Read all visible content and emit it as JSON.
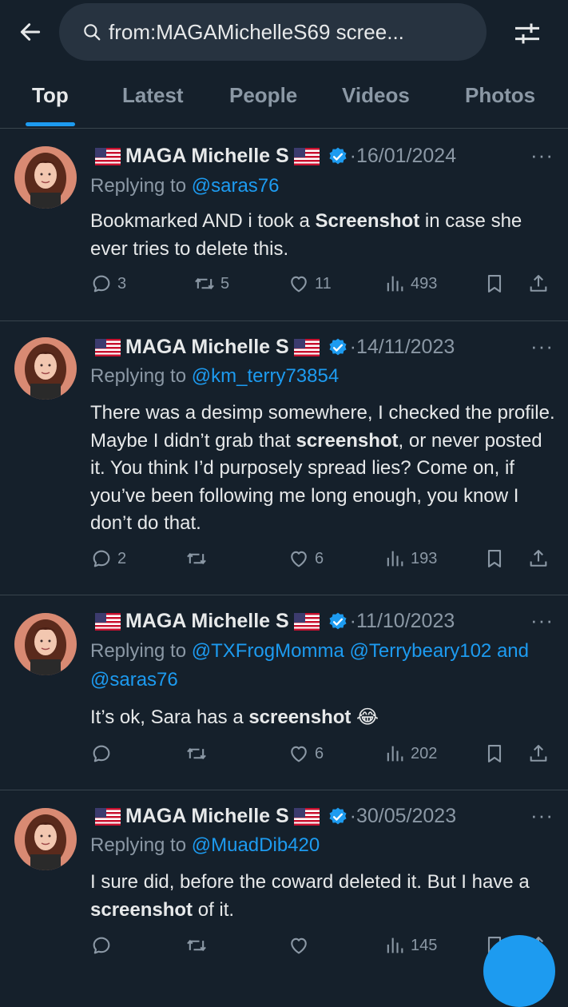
{
  "search": {
    "query": "from:MAGAMichelleS69 scree..."
  },
  "tabs": [
    {
      "label": "Top"
    },
    {
      "label": "Latest"
    },
    {
      "label": "People"
    },
    {
      "label": "Videos"
    },
    {
      "label": "Photos"
    }
  ],
  "colors": {
    "background": "#15202b",
    "accent": "#1d9bf0",
    "muted": "#8b98a5",
    "text": "#e7e9ea"
  },
  "tweets": [
    {
      "name": "MAGA Michelle S",
      "date": "·16/01/2024",
      "replying_prefix": "Replying to ",
      "mentions": [
        "@saras76"
      ],
      "text_parts": [
        "Bookmarked AND i took a ",
        "Screenshot",
        " in case she ever tries to delete this."
      ],
      "stats": {
        "replies": "3",
        "retweets": "5",
        "likes": "11",
        "views": "493"
      }
    },
    {
      "name": "MAGA Michelle S",
      "date": "·14/11/2023",
      "replying_prefix": "Replying to ",
      "mentions": [
        "@km_terry73854"
      ],
      "text_parts": [
        "There was a desimp somewhere, I checked the profile.  Maybe I didn’t grab that ",
        "screenshot",
        ", or never posted it.  You think I’d purposely spread lies?  Come on, if you’ve been following me long enough, you know I don’t do that."
      ],
      "stats": {
        "replies": "2",
        "retweets": "",
        "likes": "6",
        "views": "193"
      }
    },
    {
      "name": "MAGA Michelle S",
      "date": "·11/10/2023",
      "replying_prefix": "Replying to ",
      "mentions": [
        "@TXFrogMomma",
        "@Terrybeary102",
        "and",
        "@saras76"
      ],
      "text_parts": [
        "It’s ok, Sara has a ",
        "screenshot",
        " 😂"
      ],
      "stats": {
        "replies": "",
        "retweets": "",
        "likes": "6",
        "views": "202"
      }
    },
    {
      "name": "MAGA Michelle S",
      "date": "·30/05/2023",
      "replying_prefix": "Replying to ",
      "mentions": [
        "@MuadDib420"
      ],
      "text_parts": [
        "I sure did, before the coward deleted it. But I have a ",
        "screenshot",
        " of it."
      ],
      "stats": {
        "replies": "",
        "retweets": "",
        "likes": "",
        "views": "145"
      }
    }
  ],
  "icons": {
    "back": "back-arrow-icon",
    "search": "search-icon",
    "filter": "filter-sliders-icon",
    "more": "more-dots-icon",
    "reply": "reply-icon",
    "retweet": "retweet-icon",
    "like": "heart-icon",
    "views": "views-bar-icon",
    "bookmark": "bookmark-icon",
    "share": "share-icon",
    "verified": "verified-badge-icon",
    "flag": "us-flag-icon"
  }
}
